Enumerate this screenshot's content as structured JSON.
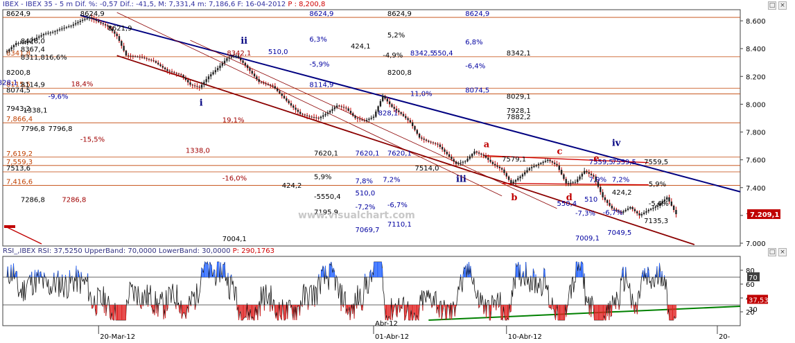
{
  "header": {
    "symbol": "IBEX",
    "name": "IBEX 35",
    "interval": "5 m",
    "dif_pct_label": "Dif. %:",
    "dif_pct": "-0,57",
    "dif_label": "Dif.:",
    "dif": "-41,5",
    "max_label": "M:",
    "max": "7,331,4",
    "min_label": "m:",
    "min": "7,186,6",
    "date_label": "F:",
    "date": "16-04-2012",
    "price_label": "P :",
    "price": "8,200,8"
  },
  "rsi_header": {
    "text": "RSI_,IBEX RSI: 37,5250 UpperBand: 70,0000 LowerBand: 30,0000",
    "price_label": "P:",
    "price": "290,1763"
  },
  "watermark": "www.visualchart.com",
  "colors": {
    "candle_down": "#c00000",
    "candle_body": "#202020",
    "trend_blue": "#000080",
    "channel_red": "#8b0000",
    "hline": "#c04000",
    "rsi_line": "#101010",
    "rsi_over": "#2060ff",
    "rsi_under": "#e02020",
    "rsi_trend": "#008000",
    "last_price_bg": "#c00000"
  },
  "chart_data": [
    {
      "type": "candlestick",
      "ylim": [
        6980,
        8680
      ],
      "y_ticks": [
        7000,
        7200,
        7400,
        7600,
        7800,
        8000,
        8200,
        8400,
        8600
      ],
      "y_tick_labels": [
        "7.000",
        "7.200",
        "7.400",
        "7.600",
        "7.800",
        "8.000",
        "8.200",
        "8.400",
        "8.600"
      ],
      "x_tick_labels": [
        "20-Mar-12",
        "01-Abr-12",
        "10-Abr-12",
        "20-"
      ],
      "x_sub_label": "Abr-12",
      "last_price": "7.209,1",
      "price_path": [
        {
          "t": 0,
          "v": 8380
        },
        {
          "t": 2,
          "v": 8440
        },
        {
          "t": 4,
          "v": 8440
        },
        {
          "t": 6,
          "v": 8470
        },
        {
          "t": 8,
          "v": 8505
        },
        {
          "t": 10,
          "v": 8520
        },
        {
          "t": 12,
          "v": 8545
        },
        {
          "t": 14,
          "v": 8565
        },
        {
          "t": 16,
          "v": 8600
        },
        {
          "t": 18,
          "v": 8625
        },
        {
          "t": 20,
          "v": 8590
        },
        {
          "t": 22,
          "v": 8560
        },
        {
          "t": 24,
          "v": 8490
        },
        {
          "t": 26,
          "v": 8350
        },
        {
          "t": 29,
          "v": 8340
        },
        {
          "t": 32,
          "v": 8310
        },
        {
          "t": 35,
          "v": 8240
        },
        {
          "t": 38,
          "v": 8210
        },
        {
          "t": 40,
          "v": 8140
        },
        {
          "t": 42,
          "v": 8120
        },
        {
          "t": 44,
          "v": 8200
        },
        {
          "t": 46,
          "v": 8260
        },
        {
          "t": 48,
          "v": 8330
        },
        {
          "t": 50,
          "v": 8350
        },
        {
          "t": 52,
          "v": 8280
        },
        {
          "t": 55,
          "v": 8160
        },
        {
          "t": 58,
          "v": 8130
        },
        {
          "t": 60,
          "v": 8060
        },
        {
          "t": 62,
          "v": 7990
        },
        {
          "t": 64,
          "v": 7930
        },
        {
          "t": 66,
          "v": 7910
        },
        {
          "t": 68,
          "v": 7900
        },
        {
          "t": 70,
          "v": 7940
        },
        {
          "t": 72,
          "v": 7990
        },
        {
          "t": 74,
          "v": 7970
        },
        {
          "t": 76,
          "v": 7900
        },
        {
          "t": 78,
          "v": 7880
        },
        {
          "t": 80,
          "v": 7910
        },
        {
          "t": 82,
          "v": 8060
        },
        {
          "t": 84,
          "v": 7980
        },
        {
          "t": 86,
          "v": 7930
        },
        {
          "t": 88,
          "v": 7870
        },
        {
          "t": 90,
          "v": 7760
        },
        {
          "t": 92,
          "v": 7730
        },
        {
          "t": 94,
          "v": 7710
        },
        {
          "t": 96,
          "v": 7640
        },
        {
          "t": 98,
          "v": 7570
        },
        {
          "t": 100,
          "v": 7590
        },
        {
          "t": 102,
          "v": 7660
        },
        {
          "t": 104,
          "v": 7630
        },
        {
          "t": 106,
          "v": 7570
        },
        {
          "t": 108,
          "v": 7530
        },
        {
          "t": 110,
          "v": 7430
        },
        {
          "t": 112,
          "v": 7480
        },
        {
          "t": 114,
          "v": 7540
        },
        {
          "t": 116,
          "v": 7570
        },
        {
          "t": 118,
          "v": 7600
        },
        {
          "t": 120,
          "v": 7560
        },
        {
          "t": 122,
          "v": 7430
        },
        {
          "t": 124,
          "v": 7440
        },
        {
          "t": 126,
          "v": 7520
        },
        {
          "t": 128,
          "v": 7480
        },
        {
          "t": 130,
          "v": 7330
        },
        {
          "t": 132,
          "v": 7250
        },
        {
          "t": 134,
          "v": 7220
        },
        {
          "t": 136,
          "v": 7260
        },
        {
          "t": 138,
          "v": 7200
        },
        {
          "t": 140,
          "v": 7240
        },
        {
          "t": 142,
          "v": 7270
        },
        {
          "t": 144,
          "v": 7330
        },
        {
          "t": 146,
          "v": 7209
        }
      ],
      "left_labels": [
        {
          "v": 8624.9,
          "text": "8624,9",
          "color": "#000000"
        },
        {
          "v": 8341.8,
          "text": "8341,8",
          "color": "#c04000"
        },
        {
          "v": 8200.8,
          "text": "8200,8",
          "color": "#000000"
        },
        {
          "v": 8115.5,
          "text": "8115,5",
          "color": "#c04000"
        },
        {
          "v": 8074.5,
          "text": "8074,5",
          "color": "#000000"
        },
        {
          "v": 7943.2,
          "text": "7943,2",
          "color": "#000000"
        },
        {
          "v": 7866.4,
          "text": "7,866,4",
          "color": "#c04000"
        },
        {
          "v": 7619.2,
          "text": "7,619,2",
          "color": "#c04000"
        },
        {
          "v": 7559.3,
          "text": "7,559,3",
          "color": "#c04000"
        },
        {
          "v": 7513.6,
          "text": "7513,6",
          "color": "#000000"
        },
        {
          "v": 7416.6,
          "text": "7,416,6",
          "color": "#c04000"
        }
      ],
      "annotations": [
        {
          "v": 8624.9,
          "t": 16,
          "text": "8624,9",
          "color": "#000000"
        },
        {
          "v": 8520,
          "t": 22,
          "text": "8621,9",
          "color": "#000000"
        },
        {
          "v": 8428.0,
          "t": 3,
          "text": "8428,0",
          "color": "#000000"
        },
        {
          "v": 8367.4,
          "t": 3,
          "text": "8367,4",
          "color": "#000000"
        },
        {
          "v": 8311.8,
          "t": 3,
          "text": "8311,816,6%",
          "color": "#000000"
        },
        {
          "v": 8114.9,
          "t": 3,
          "text": "8114,9",
          "color": "#000000"
        },
        {
          "v": 8130,
          "t": -2,
          "text": "828,1",
          "color": "#0000a0"
        },
        {
          "v": 8120,
          "t": 14,
          "text": "18,4%",
          "color": "#a00000"
        },
        {
          "v": 8030,
          "t": 9,
          "text": "-9,6%",
          "color": "#0000a0"
        },
        {
          "v": 7930,
          "t": 3,
          "text": "-1338,1",
          "color": "#000000"
        },
        {
          "v": 7796.8,
          "t": 3,
          "text": "7796,8",
          "color": "#000000"
        },
        {
          "v": 7796.8,
          "t": 9,
          "text": "7796,8",
          "color": "#000000"
        },
        {
          "v": 7720,
          "t": 16,
          "text": "-15,5%",
          "color": "#a00000"
        },
        {
          "v": 7286.8,
          "t": 3,
          "text": "7286,8",
          "color": "#000000"
        },
        {
          "v": 7286.8,
          "t": 12,
          "text": "7286,8",
          "color": "#a00000"
        },
        {
          "v": 7860,
          "t": 47,
          "text": "19,1%",
          "color": "#a00000"
        },
        {
          "v": 7640,
          "t": 39,
          "text": "1338,0",
          "color": "#a00000"
        },
        {
          "v": 7440,
          "t": 47,
          "text": "-16,0%",
          "color": "#a00000"
        },
        {
          "v": 7004.1,
          "t": 47,
          "text": "7004,1",
          "color": "#000000"
        },
        {
          "v": 8340,
          "t": 48,
          "text": "8342,1",
          "color": "#a00000"
        },
        {
          "v": 8624.9,
          "t": 66,
          "text": "8624,9",
          "color": "#0000a0"
        },
        {
          "v": 8440,
          "t": 66,
          "text": "6,3%",
          "color": "#0000a0"
        },
        {
          "v": 8350,
          "t": 57,
          "text": "510,0",
          "color": "#0000a0"
        },
        {
          "v": 8260,
          "t": 66,
          "text": "-5,9%",
          "color": "#0000a0"
        },
        {
          "v": 8114.9,
          "t": 66,
          "text": "8114,9",
          "color": "#0000a0"
        },
        {
          "v": 8624.9,
          "t": 83,
          "text": "8624,9",
          "color": "#000000"
        },
        {
          "v": 8470,
          "t": 83,
          "text": "5,2%",
          "color": "#000000"
        },
        {
          "v": 8390,
          "t": 75,
          "text": "424,1",
          "color": "#000000"
        },
        {
          "v": 8325,
          "t": 82,
          "text": "-4,9%",
          "color": "#000000"
        },
        {
          "v": 8342,
          "t": 88,
          "text": "8342,5",
          "color": "#0000a0"
        },
        {
          "v": 8342,
          "t": 93,
          "text": "550,4",
          "color": "#0000a0"
        },
        {
          "v": 8200.8,
          "t": 83,
          "text": "8200,8",
          "color": "#000000"
        },
        {
          "v": 8050,
          "t": 88,
          "text": "11,0%",
          "color": "#0000a0"
        },
        {
          "v": 7910,
          "t": 81,
          "text": "828,1",
          "color": "#0000a0"
        },
        {
          "v": 8624.9,
          "t": 100,
          "text": "8624,9",
          "color": "#0000a0"
        },
        {
          "v": 8420,
          "t": 100,
          "text": "6,8%",
          "color": "#0000a0"
        },
        {
          "v": 8250,
          "t": 100,
          "text": "-6,4%",
          "color": "#0000a0"
        },
        {
          "v": 8074.5,
          "t": 100,
          "text": "8074,5",
          "color": "#0000a0"
        },
        {
          "v": 8342.1,
          "t": 109,
          "text": "8342,1",
          "color": "#000000"
        },
        {
          "v": 8029.1,
          "t": 109,
          "text": "8029,1",
          "color": "#000000"
        },
        {
          "v": 7928.1,
          "t": 109,
          "text": "7928,1",
          "color": "#000000"
        },
        {
          "v": 7882.2,
          "t": 109,
          "text": "7882,2",
          "color": "#000000"
        },
        {
          "v": 7620.1,
          "t": 67,
          "text": "7620,1",
          "color": "#000000"
        },
        {
          "v": 7620.1,
          "t": 76,
          "text": "7620,1",
          "color": "#0000a0"
        },
        {
          "v": 7620.1,
          "t": 83,
          "text": "7620,1",
          "color": "#0000a0"
        },
        {
          "v": 7514.0,
          "t": 89,
          "text": "7514,0",
          "color": "#000000"
        },
        {
          "v": 7450,
          "t": 67,
          "text": "5,9%",
          "color": "#000000"
        },
        {
          "v": 7390,
          "t": 60,
          "text": "424,2",
          "color": "#000000"
        },
        {
          "v": 7420,
          "t": 76,
          "text": "7,8%",
          "color": "#0000a0"
        },
        {
          "v": 7430,
          "t": 82,
          "text": "7,2%",
          "color": "#0000a0"
        },
        {
          "v": 7335,
          "t": 76,
          "text": "510,0",
          "color": "#0000a0"
        },
        {
          "v": 7310,
          "t": 67,
          "text": "-5550,4",
          "color": "#000000"
        },
        {
          "v": 7235,
          "t": 76,
          "text": "-7,2%",
          "color": "#0000a0"
        },
        {
          "v": 7250,
          "t": 83,
          "text": "-6,7%",
          "color": "#0000a0"
        },
        {
          "v": 7195.9,
          "t": 67,
          "text": "7195,9",
          "color": "#000000"
        },
        {
          "v": 7069.7,
          "t": 76,
          "text": "7069,7",
          "color": "#0000a0"
        },
        {
          "v": 7110.1,
          "t": 83,
          "text": "7110,1",
          "color": "#0000a0"
        },
        {
          "v": 7579,
          "t": 108,
          "text": "7579,1",
          "color": "#000000"
        },
        {
          "v": 7559.5,
          "t": 127,
          "text": "7559,5",
          "color": "#0000a0"
        },
        {
          "v": 7559.5,
          "t": 132,
          "text": "7559,5",
          "color": "#0000a0"
        },
        {
          "v": 7559.5,
          "t": 139,
          "text": "7559,5",
          "color": "#000000"
        },
        {
          "v": 7430,
          "t": 127,
          "text": "7,9%",
          "color": "#0000a0"
        },
        {
          "v": 7430,
          "t": 132,
          "text": "7,2%",
          "color": "#0000a0"
        },
        {
          "v": 7400,
          "t": 140,
          "text": "5,9%",
          "color": "#000000"
        },
        {
          "v": 7340,
          "t": 132,
          "text": "424,2",
          "color": "#000000"
        },
        {
          "v": 7290,
          "t": 126,
          "text": "510",
          "color": "#0000a0"
        },
        {
          "v": 7260,
          "t": 120,
          "text": "550,4",
          "color": "#0000a0"
        },
        {
          "v": 7260,
          "t": 140,
          "text": "-5,6%",
          "color": "#000000"
        },
        {
          "v": 7190,
          "t": 124,
          "text": "-7,3%",
          "color": "#0000a0"
        },
        {
          "v": 7195,
          "t": 130,
          "text": "-6,7%",
          "color": "#0000a0"
        },
        {
          "v": 7135.3,
          "t": 139,
          "text": "7135,3",
          "color": "#000000"
        },
        {
          "v": 7049.5,
          "t": 131,
          "text": "7049,5",
          "color": "#0000a0"
        },
        {
          "v": 7009.1,
          "t": 124,
          "text": "7009,1",
          "color": "#0000a0"
        }
      ],
      "wave_labels": [
        {
          "v": 8435,
          "t": 51,
          "text": "ii",
          "color": "#000080"
        },
        {
          "v": 7990,
          "t": 42,
          "text": "i",
          "color": "#000080"
        },
        {
          "v": 7440,
          "t": 98,
          "text": "iii",
          "color": "#000080"
        },
        {
          "v": 7700,
          "t": 132,
          "text": "iv",
          "color": "#000080"
        },
        {
          "v": 7690,
          "t": 104,
          "text": "a",
          "color": "#c00000"
        },
        {
          "v": 7310,
          "t": 110,
          "text": "b",
          "color": "#c00000"
        },
        {
          "v": 7640,
          "t": 120,
          "text": "c",
          "color": "#c00000"
        },
        {
          "v": 7310,
          "t": 122,
          "text": "d",
          "color": "#c00000"
        },
        {
          "v": 7590,
          "t": 128,
          "text": "e",
          "color": "#c00000"
        }
      ],
      "h_levels": [
        8624.9,
        8341.8,
        8115.5,
        8074.5,
        7866.4,
        7619.2,
        7559.3,
        7513.6,
        7416.6
      ]
    },
    {
      "type": "line",
      "name": "RSI",
      "ylim": [
        0,
        100
      ],
      "y_ticks": [
        20,
        40,
        60,
        80
      ],
      "y_tick_labels": [
        "20",
        "40",
        "60",
        "80"
      ],
      "upper_band": 70,
      "lower_band": 30,
      "upper_band_label": "70",
      "lower_band_label": "30",
      "last_value": "37,53"
    }
  ]
}
